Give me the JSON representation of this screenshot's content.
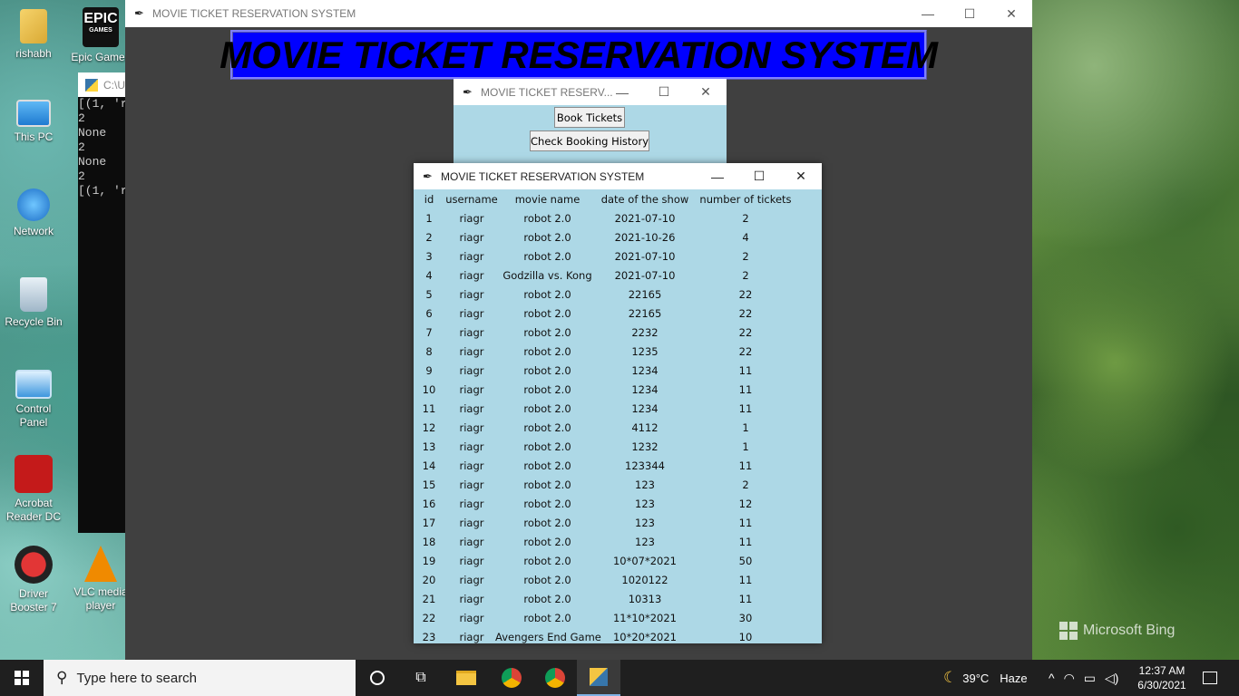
{
  "desktop": {
    "icons": [
      {
        "label": "rishabh"
      },
      {
        "label": "Epic Games"
      },
      {
        "label": "This PC"
      },
      {
        "label": "Network"
      },
      {
        "label": "Recycle Bin"
      },
      {
        "label": "Control Panel"
      },
      {
        "label": "Acrobat Reader DC"
      },
      {
        "label": "Driver Booster 7"
      },
      {
        "label": "VLC media player"
      }
    ],
    "epic_logo_text": "EPIC",
    "epic_logo_sub": "GAMES",
    "watermark": "Microsoft Bing"
  },
  "console": {
    "title": "C:\\U",
    "lines": [
      "[(1, 'r",
      "2",
      "None",
      "2",
      "None",
      "2",
      "[(1, 'r"
    ]
  },
  "main_window": {
    "title": "MOVIE TICKET RESERVATION SYSTEM",
    "banner": "MOVIE TICKET RESERVATION SYSTEM"
  },
  "menu_window": {
    "title": "MOVIE TICKET RESERV...",
    "book_button": "Book Tickets",
    "history_button": "Check Booking History"
  },
  "history_window": {
    "title": "MOVIE TICKET RESERVATION SYSTEM",
    "columns": [
      "id",
      "username",
      "movie name",
      "date of the show",
      "number of tickets"
    ],
    "rows": [
      [
        "1",
        "riagr",
        "robot 2.0",
        "2021-07-10",
        "2"
      ],
      [
        "2",
        "riagr",
        "robot 2.0",
        "2021-10-26",
        "4"
      ],
      [
        "3",
        "riagr",
        "robot 2.0",
        "2021-07-10",
        "2"
      ],
      [
        "4",
        "riagr",
        "Godzilla vs. Kong",
        "2021-07-10",
        "2"
      ],
      [
        "5",
        "riagr",
        "robot 2.0",
        "22165",
        "22"
      ],
      [
        "6",
        "riagr",
        "robot 2.0",
        "22165",
        "22"
      ],
      [
        "7",
        "riagr",
        "robot 2.0",
        "2232",
        "22"
      ],
      [
        "8",
        "riagr",
        "robot 2.0",
        "1235",
        "22"
      ],
      [
        "9",
        "riagr",
        "robot 2.0",
        "1234",
        "11"
      ],
      [
        "10",
        "riagr",
        "robot 2.0",
        "1234",
        "11"
      ],
      [
        "11",
        "riagr",
        "robot 2.0",
        "1234",
        "11"
      ],
      [
        "12",
        "riagr",
        "robot 2.0",
        "4112",
        "1"
      ],
      [
        "13",
        "riagr",
        "robot 2.0",
        "1232",
        "1"
      ],
      [
        "14",
        "riagr",
        "robot 2.0",
        "123344",
        "11"
      ],
      [
        "15",
        "riagr",
        "robot 2.0",
        "123",
        "2"
      ],
      [
        "16",
        "riagr",
        "robot 2.0",
        "123",
        "12"
      ],
      [
        "17",
        "riagr",
        "robot 2.0",
        "123",
        "11"
      ],
      [
        "18",
        "riagr",
        "robot 2.0",
        "123",
        "11"
      ],
      [
        "19",
        "riagr",
        "robot 2.0",
        "10*07*2021",
        "50"
      ],
      [
        "20",
        "riagr",
        "robot 2.0",
        "1020122",
        "11"
      ],
      [
        "21",
        "riagr",
        "robot 2.0",
        "10313",
        "11"
      ],
      [
        "22",
        "riagr",
        "robot 2.0",
        "11*10*2021",
        "30"
      ],
      [
        "23",
        "riagr",
        "Avengers End Game",
        "10*20*2021",
        "10"
      ]
    ]
  },
  "taskbar": {
    "search_placeholder": "Type here to search",
    "weather": "39°C",
    "weather_desc": "Haze",
    "time": "12:37 AM",
    "date": "6/30/2021",
    "apps": [
      "task-view",
      "file-explorer",
      "chrome-profile",
      "chrome",
      "python"
    ]
  }
}
